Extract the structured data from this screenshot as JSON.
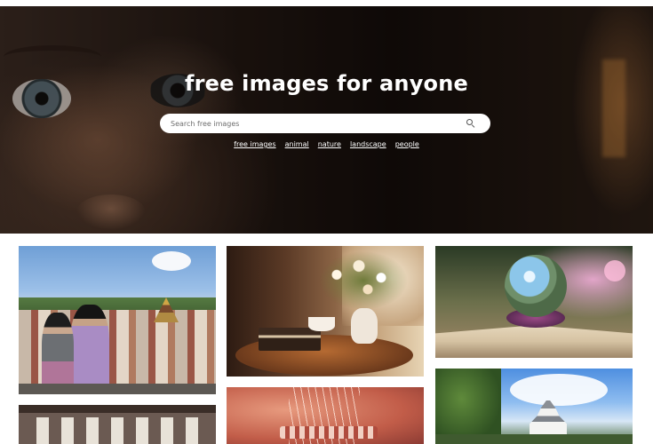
{
  "hero": {
    "title": "free images for anyone",
    "search": {
      "placeholder": "Search free images",
      "value": ""
    },
    "links": [
      {
        "label": "free images"
      },
      {
        "label": "animal"
      },
      {
        "label": "nature"
      },
      {
        "label": "landscape"
      },
      {
        "label": "people"
      }
    ]
  },
  "gallery": {
    "tiles": [
      {
        "subject": "two women seated above a temple city under blue sky"
      },
      {
        "subject": "coffee cup, books and flower vase on a round table by a window"
      },
      {
        "subject": "glowing crystal globe with fantasy castle on an open book"
      },
      {
        "subject": "outdoor workshop with hanging cloths"
      },
      {
        "subject": "red string art close-up"
      },
      {
        "subject": "white Japanese castle behind trees under blue sky"
      }
    ]
  }
}
